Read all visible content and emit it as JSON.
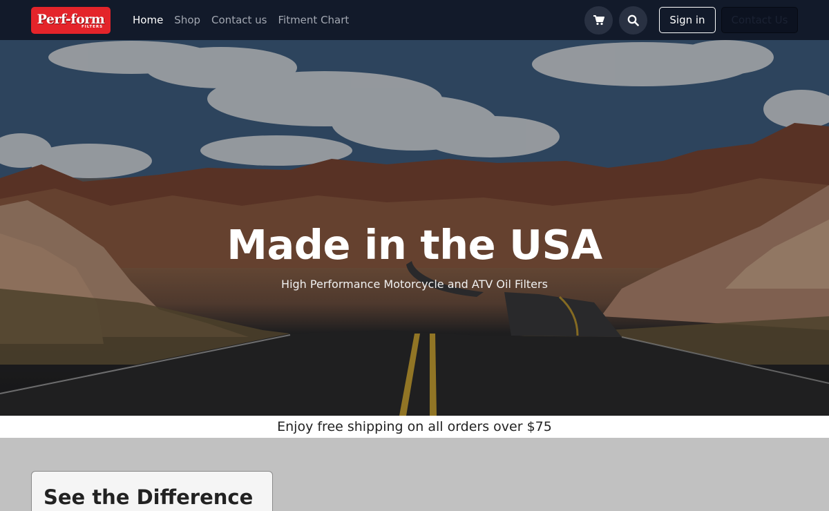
{
  "brand": {
    "logo_text": "Perf-form",
    "logo_sub": "FILTERS"
  },
  "nav": {
    "links": [
      {
        "label": "Home",
        "active": true
      },
      {
        "label": "Shop"
      },
      {
        "label": "Contact us"
      },
      {
        "label": "Fitment Chart"
      }
    ],
    "cart_icon": "cart-icon",
    "search_icon": "search-icon",
    "signin_label": "Sign in",
    "contact_label": "Contact Us"
  },
  "hero": {
    "title": "Made in the USA",
    "subtitle": "High Performance Motorcycle and ATV Oil Filters"
  },
  "banner": {
    "text": "Enjoy free shipping on all orders over $75"
  },
  "feature_card": {
    "title": "See the Difference"
  },
  "colors": {
    "navbar_bg": "#121a2a",
    "logo_red": "#e4242a",
    "page_bg": "#c1c1c1"
  }
}
